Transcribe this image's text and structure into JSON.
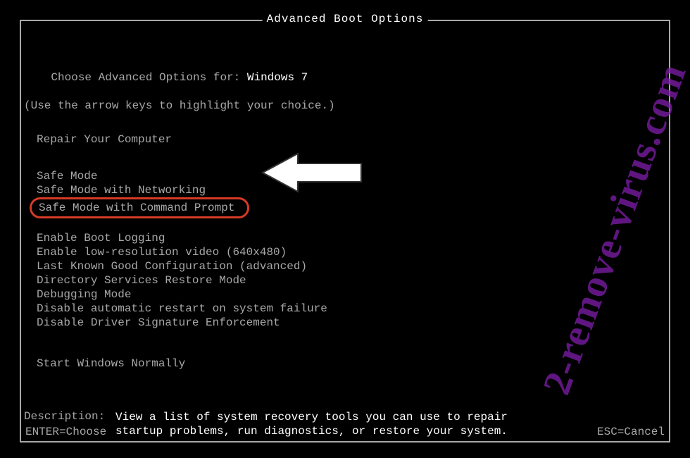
{
  "title": "Advanced Boot Options",
  "intro": {
    "line1_prefix": "Choose Advanced Options for: ",
    "os_name": "Windows 7",
    "line2": "(Use the arrow keys to highlight your choice.)"
  },
  "groups": [
    {
      "items": [
        "Repair Your Computer"
      ]
    },
    {
      "items": [
        "Safe Mode",
        "Safe Mode with Networking",
        "Safe Mode with Command Prompt"
      ],
      "highlighted_index": 2
    },
    {
      "items": [
        "Enable Boot Logging",
        "Enable low-resolution video (640x480)",
        "Last Known Good Configuration (advanced)",
        "Directory Services Restore Mode",
        "Debugging Mode",
        "Disable automatic restart on system failure",
        "Disable Driver Signature Enforcement"
      ]
    },
    {
      "items": [
        "Start Windows Normally"
      ]
    }
  ],
  "description": {
    "label": "Description:",
    "text1": "View a list of system recovery tools you can use to repair",
    "text2": "startup problems, run diagnostics, or restore your system."
  },
  "footer": {
    "left": "ENTER=Choose",
    "right": "ESC=Cancel"
  },
  "watermark": "2-remove-virus.com",
  "colors": {
    "highlight_border": "#d53a26",
    "watermark": "#7b1da4"
  }
}
